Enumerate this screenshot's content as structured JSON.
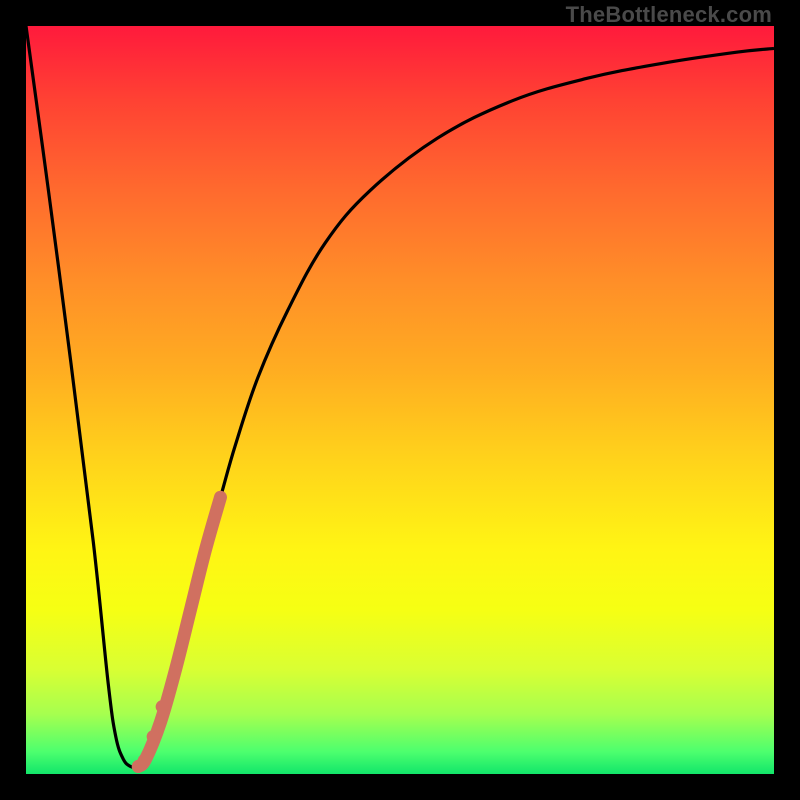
{
  "watermark": "TheBottleneck.com",
  "chart_data": {
    "type": "line",
    "title": "",
    "xlabel": "",
    "ylabel": "",
    "xlim": [
      0,
      100
    ],
    "ylim": [
      0,
      100
    ],
    "grid": false,
    "legend": false,
    "series": [
      {
        "name": "bottleneck-curve",
        "x": [
          0,
          3,
          6,
          9,
          11,
          12,
          13,
          14,
          15,
          16,
          18,
          20,
          22,
          24,
          26,
          28,
          31,
          35,
          40,
          46,
          55,
          65,
          75,
          85,
          95,
          100
        ],
        "values": [
          100,
          78,
          55,
          31,
          12,
          5,
          2,
          1,
          1,
          2,
          7,
          14,
          22,
          30,
          37,
          44,
          53,
          62,
          71,
          78,
          85,
          90,
          93,
          95,
          96.5,
          97
        ]
      }
    ],
    "highlight_segment": {
      "name": "highlighted-range",
      "color": "#d07060",
      "x": [
        15,
        16,
        18,
        20,
        22,
        24,
        26
      ],
      "values": [
        1,
        2,
        7,
        14,
        22,
        30,
        37
      ]
    },
    "highlight_dots": {
      "name": "highlighted-dots",
      "color": "#d07060",
      "points": [
        {
          "x": 15.8,
          "y": 1.8
        },
        {
          "x": 17.0,
          "y": 5.0
        },
        {
          "x": 18.2,
          "y": 9.0
        }
      ]
    },
    "colors": {
      "curve": "#000000",
      "highlight": "#d07060",
      "background_top": "#ff1a3c",
      "background_mid": "#fff514",
      "background_bottom": "#12e66a",
      "frame": "#000000"
    }
  }
}
